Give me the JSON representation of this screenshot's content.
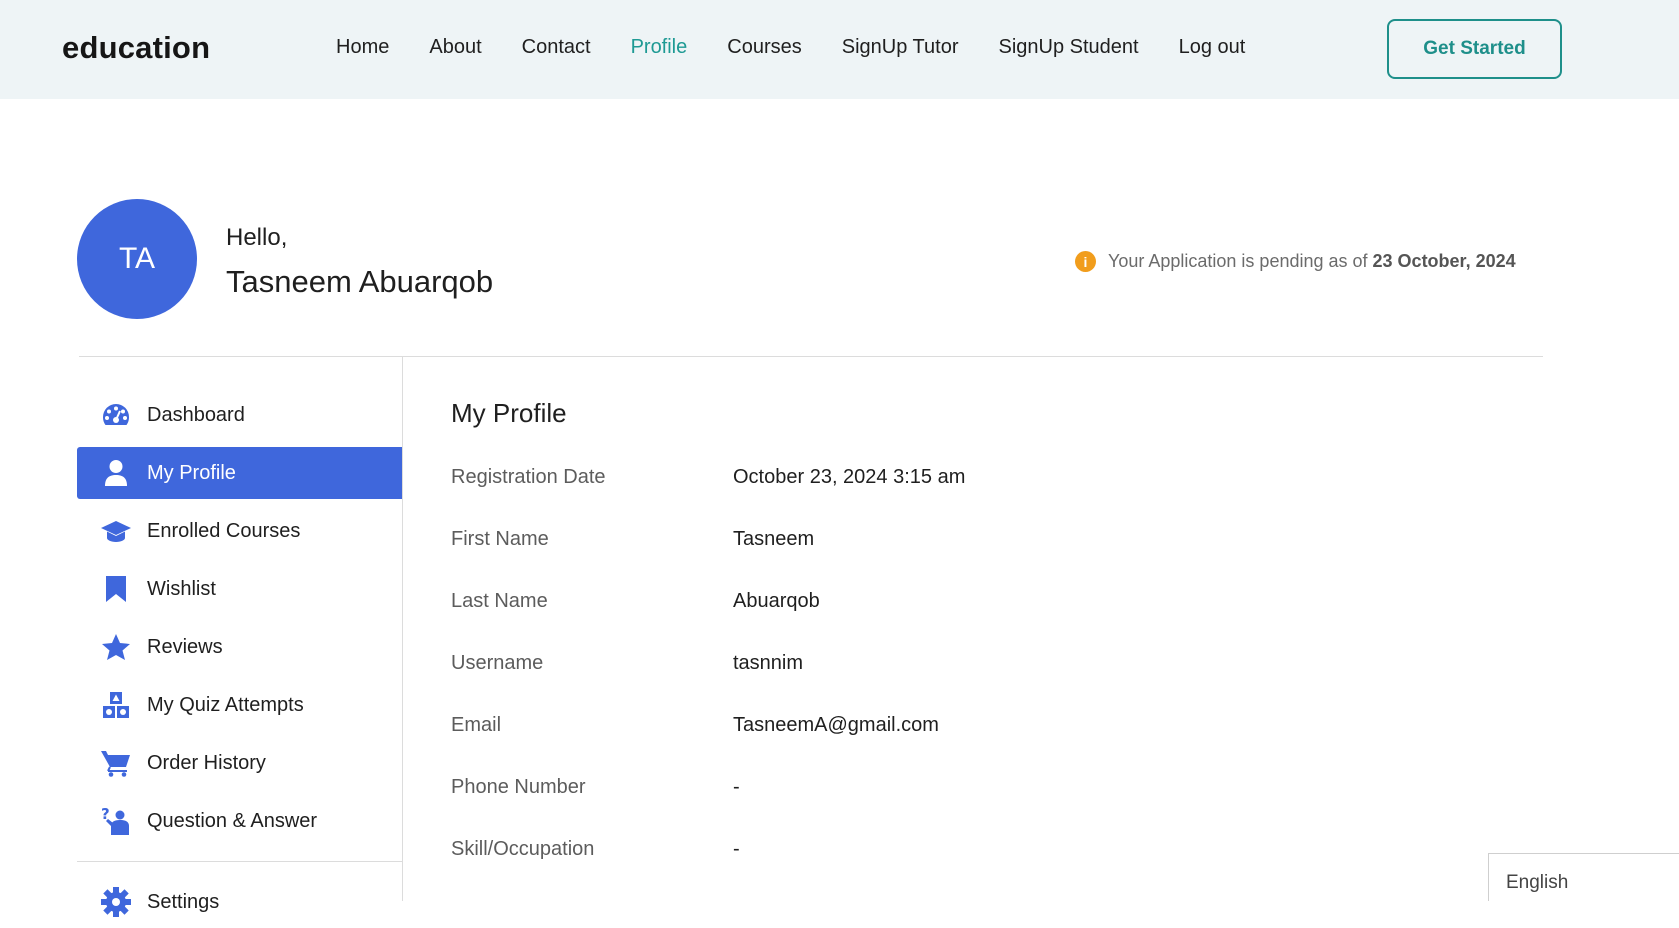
{
  "header": {
    "brand": "education",
    "nav": [
      "Home",
      "About",
      "Contact",
      "Profile",
      "Courses",
      "SignUp Tutor",
      "SignUp Student",
      "Log out"
    ],
    "active_nav": "Profile",
    "cta_label": "Get Started",
    "accent_color": "#1e9a94"
  },
  "profile": {
    "initials": "TA",
    "greeting": "Hello,",
    "full_name": "Tasneem Abuarqob",
    "status_prefix": "Your Application is pending as of",
    "status_date": "23 October, 2024",
    "avatar_color": "#3f67dc"
  },
  "sidebar": {
    "items": [
      {
        "label": "Dashboard",
        "icon": "dashboard-icon"
      },
      {
        "label": "My Profile",
        "icon": "user-icon",
        "active": true
      },
      {
        "label": "Enrolled Courses",
        "icon": "graduation-cap-icon"
      },
      {
        "label": "Wishlist",
        "icon": "bookmark-icon"
      },
      {
        "label": "Reviews",
        "icon": "star-icon"
      },
      {
        "label": "My Quiz Attempts",
        "icon": "shapes-icon"
      },
      {
        "label": "Order History",
        "icon": "cart-icon"
      },
      {
        "label": "Question & Answer",
        "icon": "question-person-icon"
      },
      {
        "label": "Settings",
        "icon": "gear-icon"
      }
    ]
  },
  "main": {
    "title": "My Profile",
    "rows": [
      {
        "label": "Registration Date",
        "value": "October 23, 2024 3:15 am"
      },
      {
        "label": "First Name",
        "value": "Tasneem"
      },
      {
        "label": "Last Name",
        "value": "Abuarqob"
      },
      {
        "label": "Username",
        "value": "tasnnim"
      },
      {
        "label": "Email",
        "value": "TasneemA@gmail.com"
      },
      {
        "label": "Phone Number",
        "value": "-"
      },
      {
        "label": "Skill/Occupation",
        "value": "-"
      }
    ]
  },
  "language": {
    "selected": "English"
  }
}
